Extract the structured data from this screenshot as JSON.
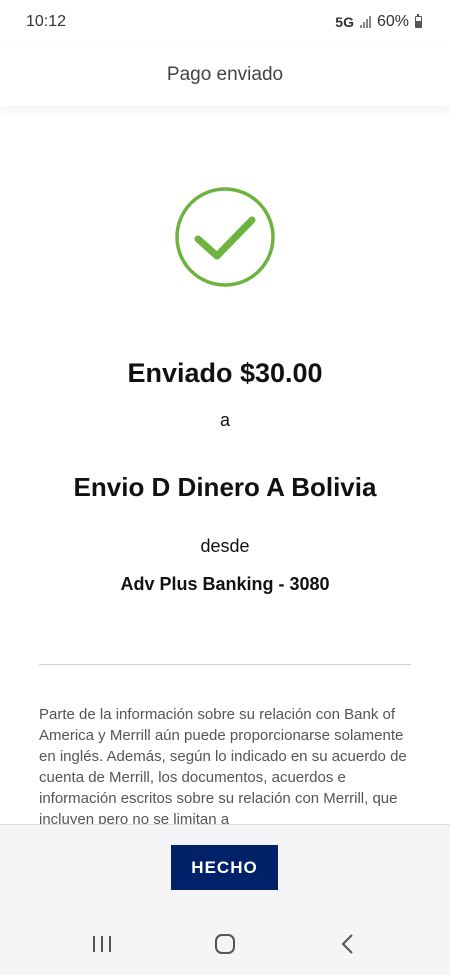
{
  "status_bar": {
    "time": "10:12",
    "network": "5G",
    "battery": "60%"
  },
  "header": {
    "title": "Pago enviado"
  },
  "confirmation": {
    "icon": "checkmark-circle-icon",
    "sent_text": "Enviado $30.00",
    "to_word": "a",
    "recipient": "Envio D Dinero A Bolivia",
    "from_word": "desde",
    "account": "Adv Plus Banking - 3080"
  },
  "disclaimer": {
    "text": "Parte de la información sobre su relación con Bank of America y Merrill aún puede proporcionarse solamente en inglés. Además, según lo indicado en su acuerdo de cuenta de Merrill, los documentos, acuerdos e información escritos sobre su relación con Merrill, que incluyen pero no se limitan a"
  },
  "footer": {
    "done_label": "HECHO"
  },
  "nav": {
    "icons": [
      "recent-apps-icon",
      "home-icon",
      "back-icon"
    ]
  },
  "colors": {
    "accent_green": "#6db33f",
    "button_navy": "#012169"
  }
}
